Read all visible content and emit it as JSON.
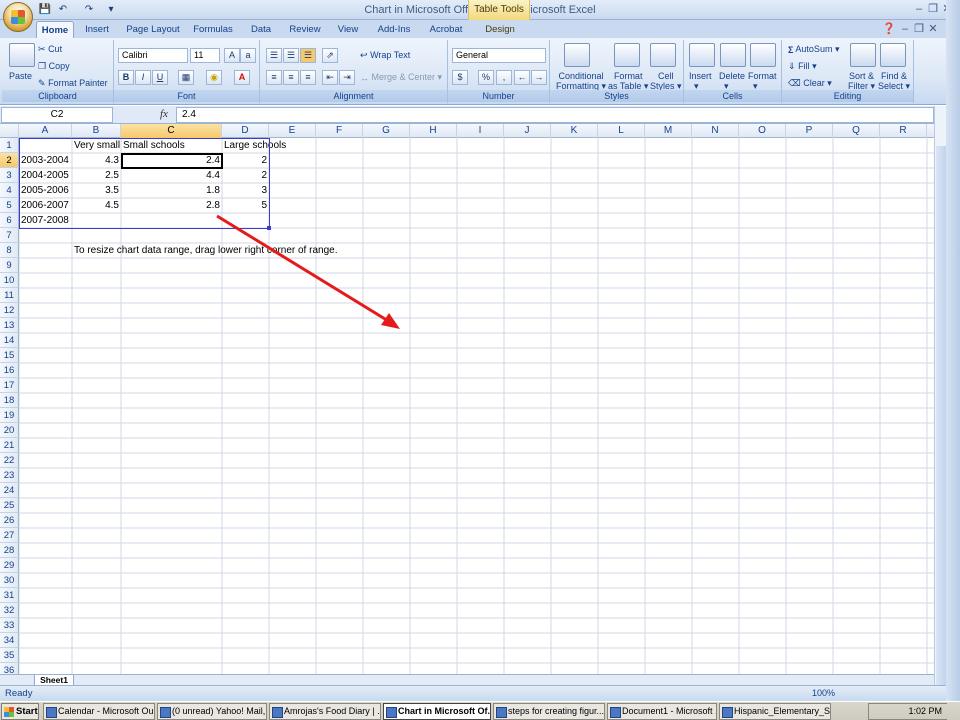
{
  "window": {
    "title": "Chart in Microsoft Office Word - Microsoft Excel",
    "context_tab": "Table Tools"
  },
  "tabs": [
    "Home",
    "Insert",
    "Page Layout",
    "Formulas",
    "Data",
    "Review",
    "View",
    "Add-Ins",
    "Acrobat",
    "Design"
  ],
  "ribbon": {
    "clipboard": {
      "label": "Clipboard",
      "paste": "Paste",
      "cut": "Cut",
      "copy": "Copy",
      "format_painter": "Format Painter"
    },
    "font": {
      "label": "Font",
      "name": "Calibri",
      "size": "11",
      "bold": "B",
      "italic": "I",
      "underline": "U"
    },
    "alignment": {
      "label": "Alignment",
      "wrap_text": "Wrap Text",
      "merge_center": "Merge & Center"
    },
    "number": {
      "label": "Number",
      "format": "General",
      "currency": "$",
      "percent": "%",
      "comma": ","
    },
    "styles": {
      "label": "Styles",
      "conditional": "Conditional",
      "conditional2": "Formatting",
      "format_table": "Format",
      "format_table2": "as Table",
      "cell_styles": "Cell",
      "cell_styles2": "Styles"
    },
    "cells": {
      "label": "Cells",
      "insert": "Insert",
      "delete": "Delete",
      "format": "Format"
    },
    "editing": {
      "label": "Editing",
      "autosum": "AutoSum",
      "fill": "Fill",
      "clear": "Clear",
      "sort": "Sort &",
      "sort2": "Filter",
      "find": "Find &",
      "find2": "Select"
    }
  },
  "formula_bar": {
    "name_box": "C2",
    "fx": "fx",
    "content": "2.4"
  },
  "columns": [
    "A",
    "B",
    "C",
    "D",
    "E",
    "F",
    "G",
    "H",
    "I",
    "J",
    "K",
    "L",
    "M",
    "N",
    "O",
    "P",
    "Q",
    "R"
  ],
  "rows": [
    "1",
    "2",
    "3",
    "4",
    "5",
    "6",
    "7",
    "8",
    "9",
    "10",
    "11",
    "12",
    "13",
    "14",
    "15",
    "16",
    "17",
    "18",
    "19",
    "20",
    "21",
    "22",
    "23",
    "24",
    "25",
    "26",
    "27",
    "28",
    "29",
    "30",
    "31",
    "32",
    "33",
    "34",
    "35",
    "36"
  ],
  "cells": {
    "B1": "Very small",
    "C1": "Small schools",
    "D1": "Large schools",
    "A2": "2003-2004",
    "B2": "4.3",
    "C2": "2.4",
    "D2": "2",
    "A3": "2004-2005",
    "B3": "2.5",
    "C3": "4.4",
    "D3": "2",
    "A4": "2005-2006",
    "B4": "3.5",
    "C4": "1.8",
    "D4": "3",
    "A5": "2006-2007",
    "B5": "4.5",
    "C5": "2.8",
    "D5": "5",
    "A6": "2007-2008",
    "B8": "To resize chart data range, drag lower right corner of range."
  },
  "sheet_tab": "Sheet1",
  "status": {
    "ready": "Ready",
    "zoom": "100%"
  },
  "taskbar": {
    "start": "Start",
    "items": [
      "Calendar - Microsoft Ou...",
      "(0 unread) Yahoo! Mail,...",
      "Amrojas's Food Diary | ...",
      "Chart in Microsoft Of...",
      "steps for creating figur...",
      "Document1 - Microsoft ...",
      "Hispanic_Elementary_S..."
    ],
    "clock": "1:02 PM"
  },
  "colors": {
    "selection": "#000000",
    "range_border": "#3b3bd0",
    "arrow": "#e51b1b"
  }
}
